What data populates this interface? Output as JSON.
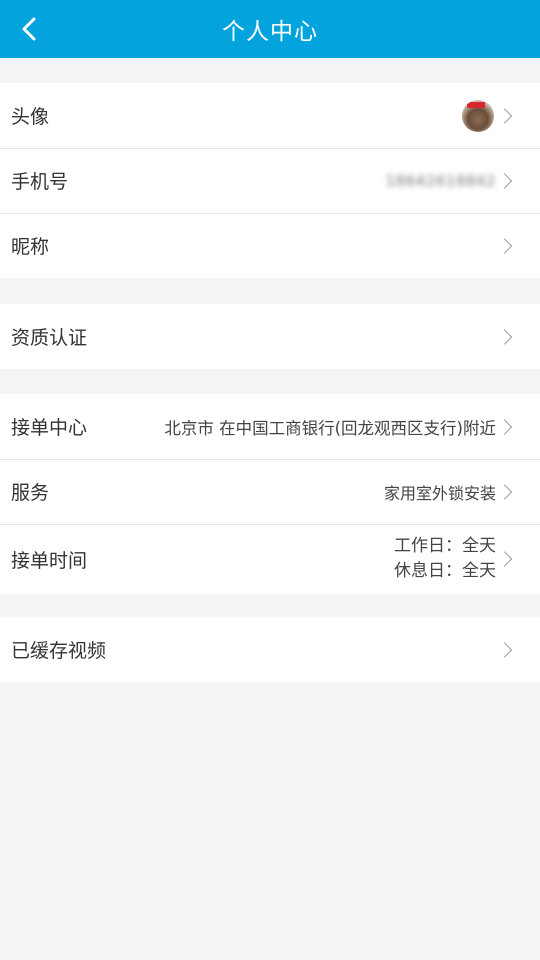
{
  "header": {
    "title": "个人中心"
  },
  "profile": {
    "avatar_label": "头像",
    "phone_label": "手机号",
    "phone_value": "18642618842",
    "nickname_label": "昵称"
  },
  "qualification": {
    "label": "资质认证"
  },
  "orders": {
    "center_label": "接单中心",
    "center_value": "北京市 在中国工商银行(回龙观西区支行)附近",
    "service_label": "服务",
    "service_value": "家用室外锁安装",
    "time_label": "接单时间",
    "workday": "工作日：全天",
    "restday": "休息日：全天"
  },
  "videos": {
    "label": "已缓存视频"
  }
}
